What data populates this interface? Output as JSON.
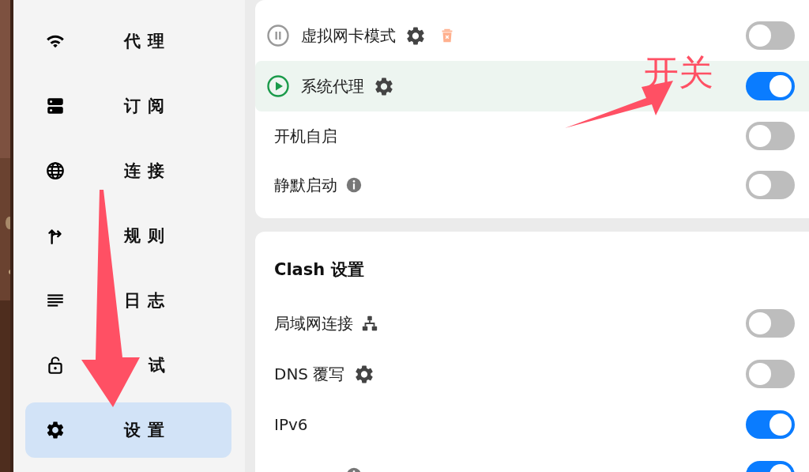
{
  "sidebar": {
    "items": [
      {
        "label": "代理",
        "selected": false
      },
      {
        "label": "订阅",
        "selected": false
      },
      {
        "label": "连接",
        "selected": false
      },
      {
        "label": "规则",
        "selected": false
      },
      {
        "label": "日志",
        "selected": false
      },
      {
        "label": "试",
        "selected": false
      },
      {
        "label": "设置",
        "selected": true
      }
    ]
  },
  "cards": [
    {
      "rows": [
        {
          "kind": "mode",
          "label": "虚拟网卡模式",
          "active": false,
          "on": false
        },
        {
          "kind": "mode",
          "label": "系统代理",
          "active": true,
          "on": true
        },
        {
          "kind": "plain",
          "label": "开机自启",
          "on": false
        },
        {
          "kind": "plain",
          "label": "静默启动",
          "on": false
        }
      ]
    },
    {
      "title": "Clash 设置",
      "rows": [
        {
          "kind": "plain",
          "label": "局域网连接",
          "on": false
        },
        {
          "kind": "plain",
          "label": "DNS 覆写",
          "on": false
        },
        {
          "kind": "plain",
          "label": "IPv6",
          "on": true
        },
        {
          "kind": "plain",
          "on": true
        }
      ]
    }
  ],
  "annotation": {
    "label": "开关"
  }
}
